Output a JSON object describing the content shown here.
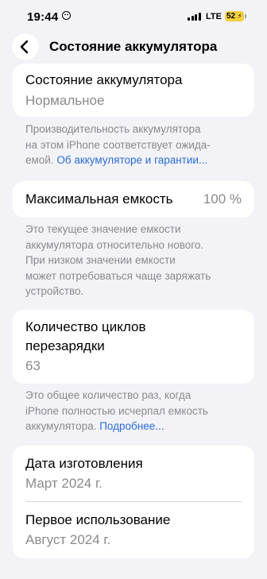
{
  "status_bar": {
    "time": "19:44",
    "network": "LTE",
    "battery_percent": "52"
  },
  "nav": {
    "title": "Состояние аккумулятора"
  },
  "health_card": {
    "label": "Состояние аккумулятора",
    "value": "Нормальное"
  },
  "health_footnote": {
    "line1": "Производительность аккумулятора",
    "line2": "на этом iPhone соответствует ожида-",
    "line3_text": "емой. ",
    "line3_link": "Об аккумуляторе и гарантии..."
  },
  "capacity_card": {
    "label": "Максимальная емкость",
    "value": "100 %"
  },
  "capacity_footnote": {
    "line1": "Это текущее значение емкости",
    "line2": "аккумулятора относительно нового.",
    "line3": "При низком значении емкости",
    "line4": "может потребоваться чаще заряжать",
    "line5": "устройство."
  },
  "cycles_card": {
    "label_line1": "Количество циклов",
    "label_line2": "перезарядки",
    "value": "63"
  },
  "cycles_footnote": {
    "line1": "Это общее количество раз, когда",
    "line2": "iPhone полностью исчерпал емкость",
    "line3_text": "аккумулятора. ",
    "line3_link": "Подробнее..."
  },
  "dates_card": {
    "manufacture_label": "Дата изготовления",
    "manufacture_value": "Март 2024 г.",
    "first_use_label": "Первое использование",
    "first_use_value": "Август 2024 г."
  }
}
